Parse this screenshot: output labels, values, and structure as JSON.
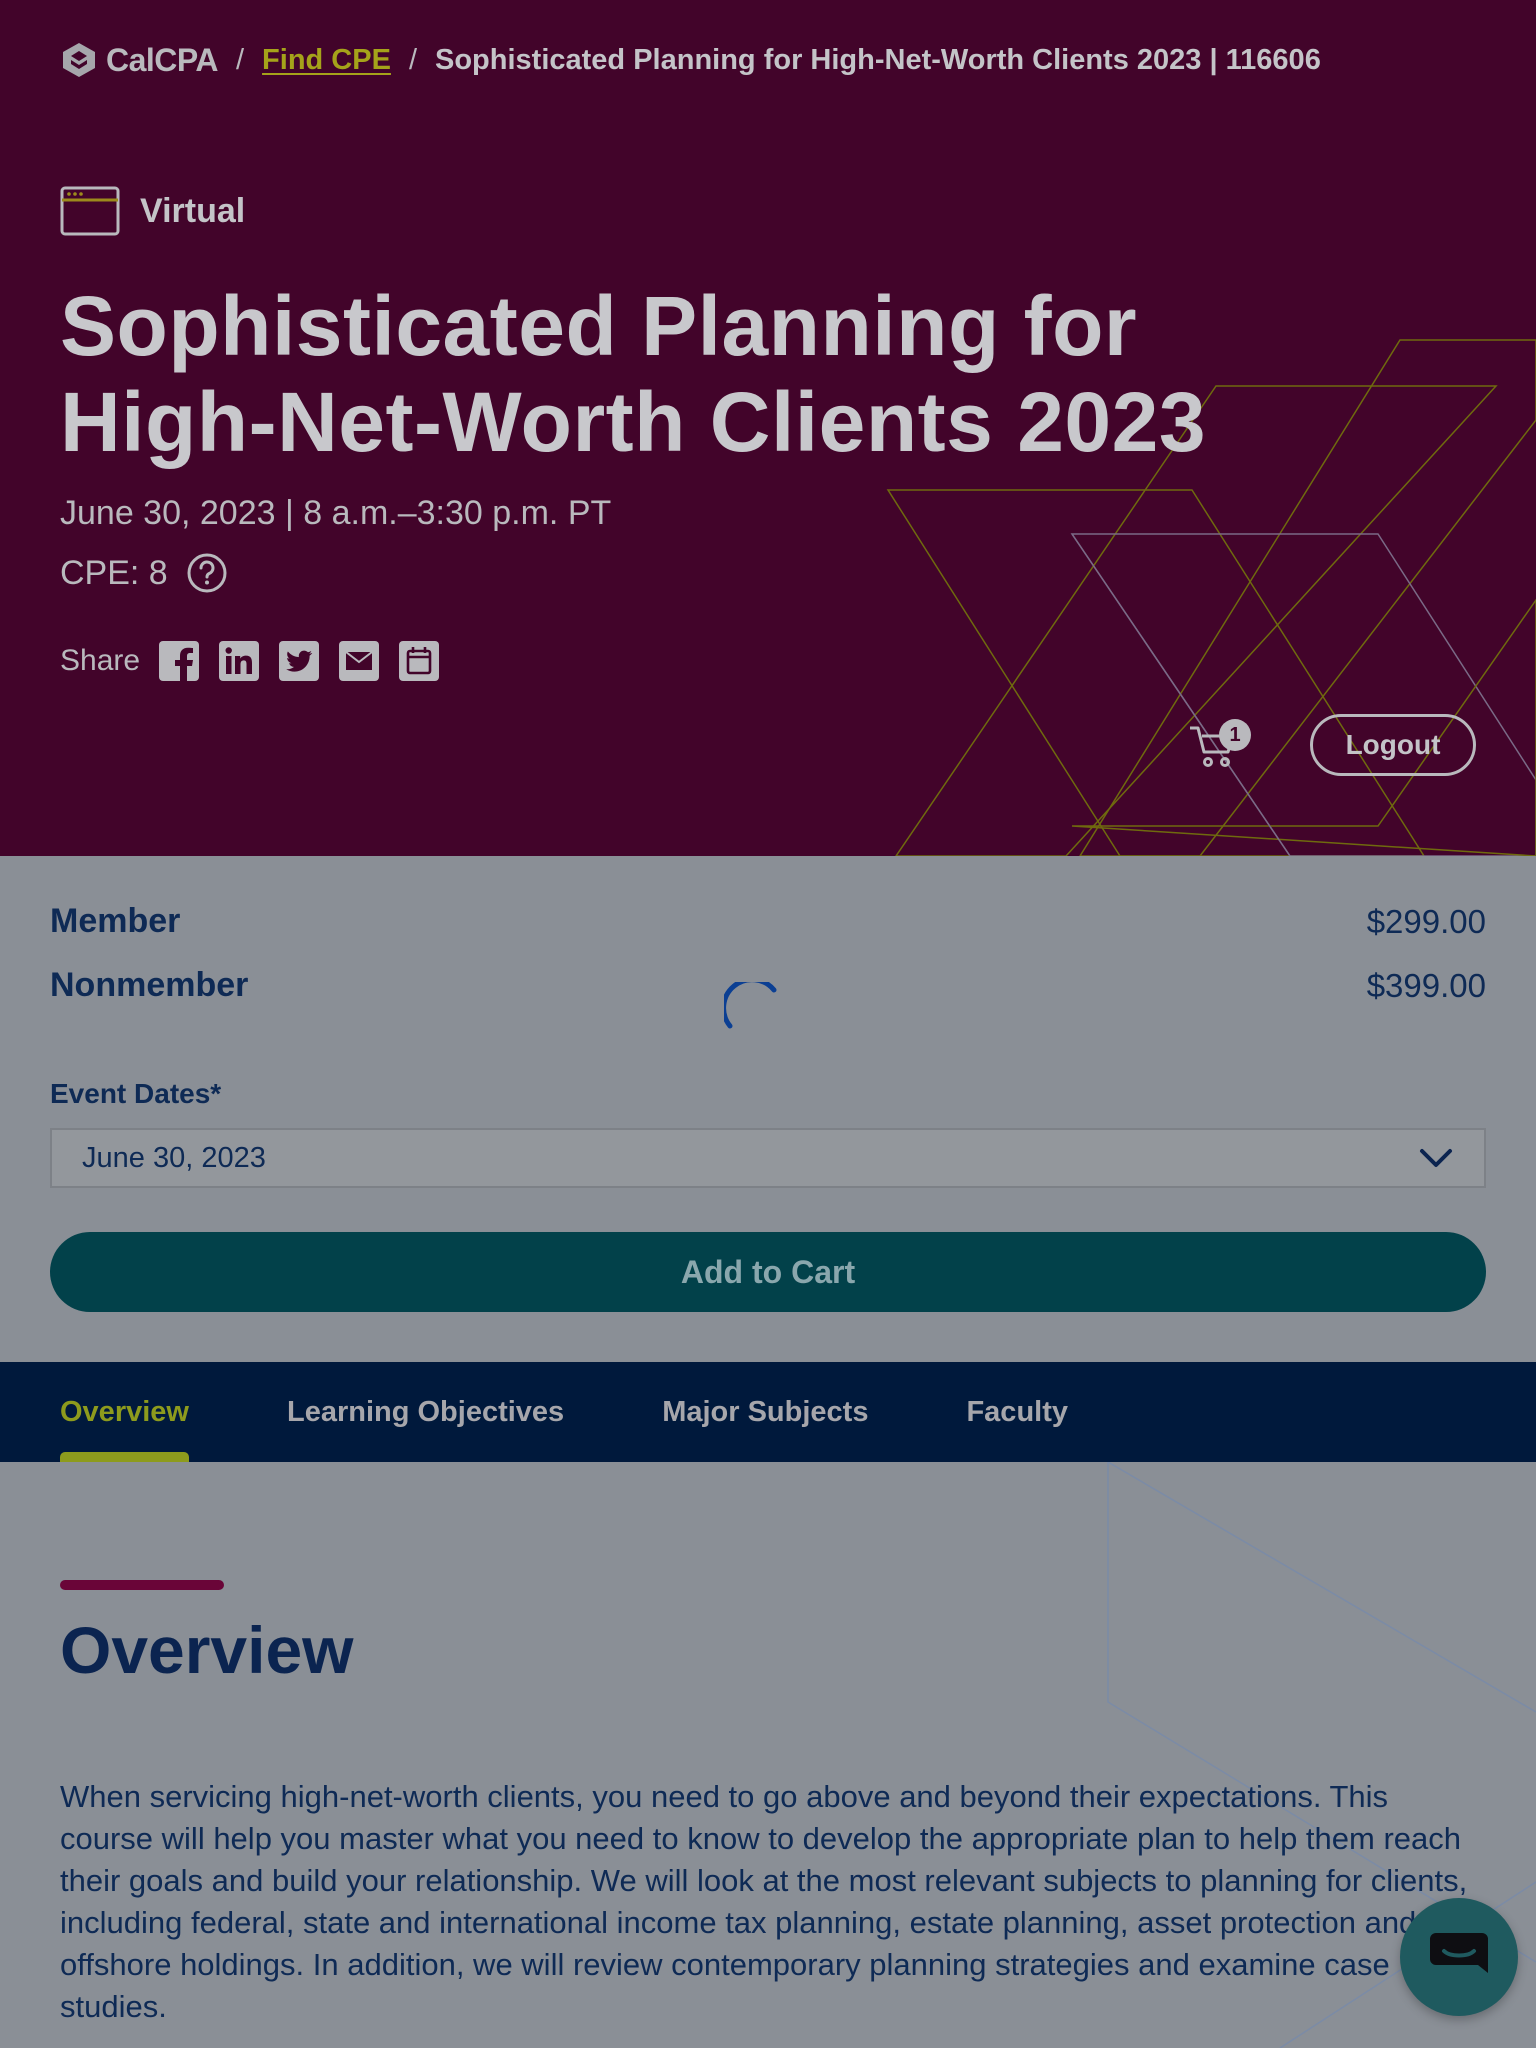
{
  "breadcrumb": {
    "brand": "CalCPA",
    "separator": "/",
    "link": "Find CPE",
    "current": "Sophisticated Planning for High-Net-Worth Clients 2023 | 116606"
  },
  "event": {
    "format": "Virtual",
    "title": "Sophisticated Planning for High-Net-Worth Clients 2023",
    "date_time": "June 30, 2023 | 8 a.m.–3:30 p.m. PT",
    "cpe": "CPE: 8"
  },
  "share": {
    "label": "Share",
    "icons": [
      "facebook-icon",
      "linkedin-icon",
      "twitter-icon",
      "email-icon",
      "calendar-icon"
    ]
  },
  "header": {
    "cart_count": "1",
    "logout_label": "Logout"
  },
  "pricing": [
    {
      "label": "Member",
      "price": "$299.00"
    },
    {
      "label": "Nonmember",
      "price": "$399.00"
    }
  ],
  "event_dates": {
    "label": "Event Dates*",
    "selected": "June 30, 2023"
  },
  "add_to_cart_label": "Add to Cart",
  "tabs": [
    {
      "label": "Overview",
      "active": true
    },
    {
      "label": "Learning Objectives",
      "active": false
    },
    {
      "label": "Major Subjects",
      "active": false
    },
    {
      "label": "Faculty",
      "active": false
    }
  ],
  "overview": {
    "heading": "Overview",
    "text": "When servicing high-net-worth clients, you need to go above and beyond their expectations. This course will help you master what you need to know to develop the appropriate plan to help them reach their goals and build your relationship. We will look at the most relevant subjects to planning for clients, including federal, state and international income tax planning, estate planning, asset protection and offshore holdings. In addition, we will review contemporary planning strategies and examine case studies."
  },
  "colors": {
    "hero_bg": "#42042a",
    "accent_green": "#8d9b1d",
    "navy": "#0e2a55",
    "teal_button": "#02414a",
    "tabs_bg": "#00193c"
  }
}
